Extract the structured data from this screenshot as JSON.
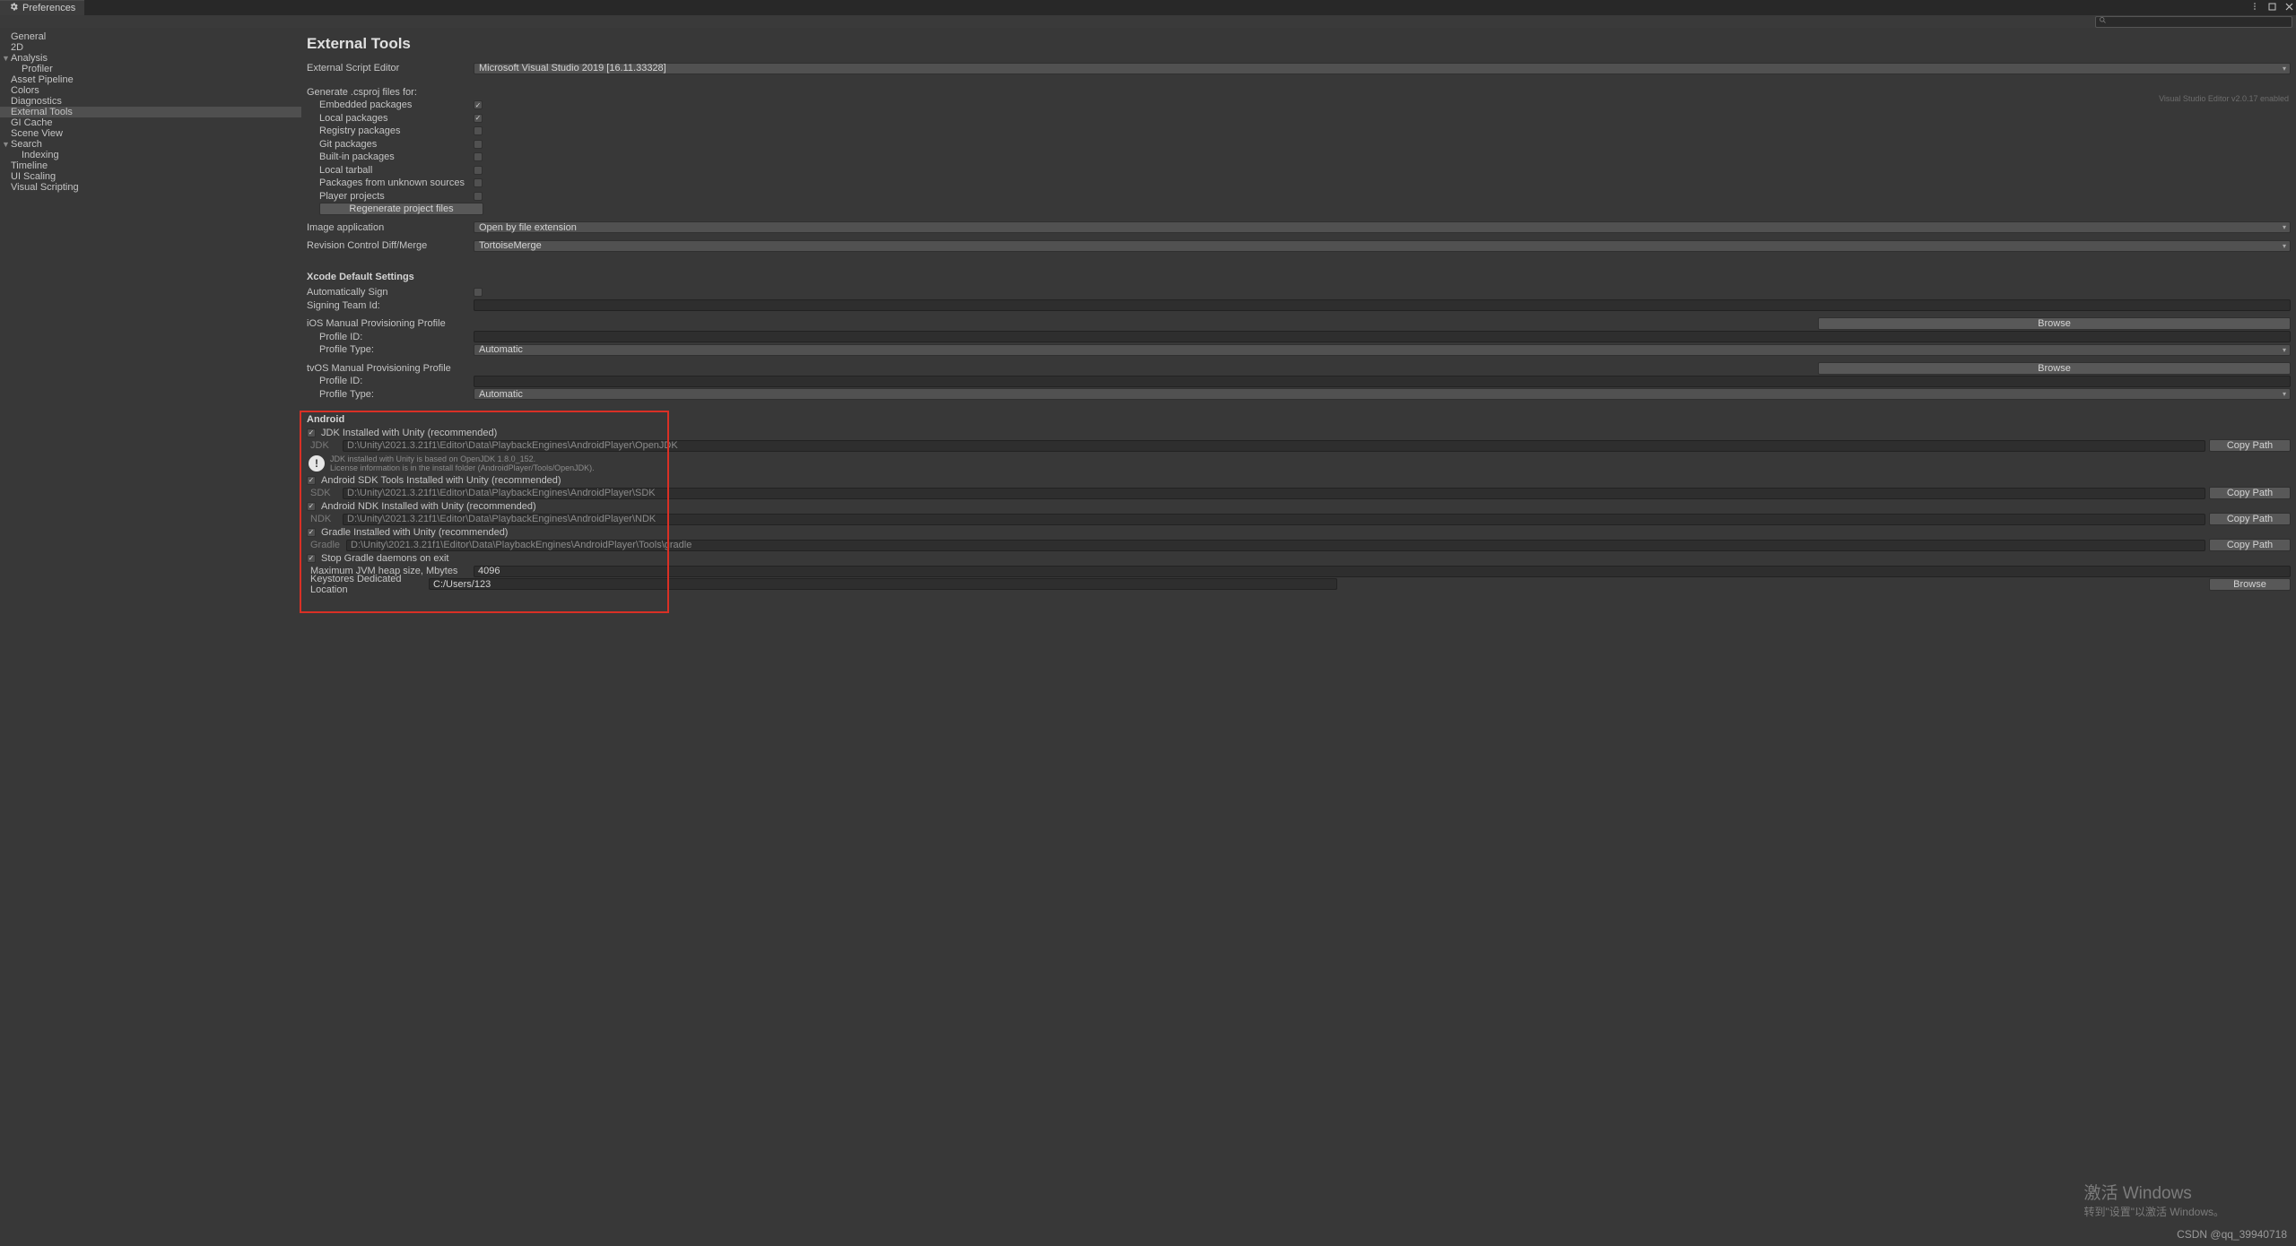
{
  "titlebar": {
    "tab_label": "Preferences"
  },
  "sidebar": {
    "items": [
      {
        "label": "General",
        "lvl": 0
      },
      {
        "label": "2D",
        "lvl": 0
      },
      {
        "label": "Analysis",
        "lvl": 0,
        "fold": true
      },
      {
        "label": "Profiler",
        "lvl": 1
      },
      {
        "label": "Asset Pipeline",
        "lvl": 0
      },
      {
        "label": "Colors",
        "lvl": 0
      },
      {
        "label": "Diagnostics",
        "lvl": 0
      },
      {
        "label": "External Tools",
        "lvl": 0,
        "sel": true
      },
      {
        "label": "GI Cache",
        "lvl": 0
      },
      {
        "label": "Scene View",
        "lvl": 0
      },
      {
        "label": "Search",
        "lvl": 0,
        "fold": true
      },
      {
        "label": "Indexing",
        "lvl": 1
      },
      {
        "label": "Timeline",
        "lvl": 0
      },
      {
        "label": "UI Scaling",
        "lvl": 0
      },
      {
        "label": "Visual Scripting",
        "lvl": 0
      }
    ]
  },
  "page": {
    "title": "External Tools",
    "editor_note": "Visual Studio Editor v2.0.17 enabled",
    "script_editor_label": "External Script Editor",
    "script_editor_value": "Microsoft Visual Studio 2019 [16.11.33328]",
    "csproj_header": "Generate .csproj files for:",
    "csproj": [
      {
        "label": "Embedded packages",
        "checked": true
      },
      {
        "label": "Local packages",
        "checked": true
      },
      {
        "label": "Registry packages",
        "checked": false
      },
      {
        "label": "Git packages",
        "checked": false
      },
      {
        "label": "Built-in packages",
        "checked": false
      },
      {
        "label": "Local tarball",
        "checked": false
      },
      {
        "label": "Packages from unknown sources",
        "checked": false
      },
      {
        "label": "Player projects",
        "checked": false
      }
    ],
    "regen_btn": "Regenerate project files",
    "image_app_label": "Image application",
    "image_app_value": "Open by file extension",
    "diffmerge_label": "Revision Control Diff/Merge",
    "diffmerge_value": "TortoiseMerge",
    "xcode_header": "Xcode Default Settings",
    "auto_sign_label": "Automatically Sign",
    "team_id_label": "Signing Team Id:",
    "ios_header": "iOS Manual Provisioning Profile",
    "tvos_header": "tvOS Manual Provisioning Profile",
    "profile_id_label": "Profile ID:",
    "profile_type_label": "Profile Type:",
    "profile_type_value": "Automatic",
    "browse_btn": "Browse",
    "android_header": "Android",
    "jdk_chk": "JDK Installed with Unity (recommended)",
    "jdk_label": "JDK",
    "jdk_path": "D:\\Unity\\2021.3.21f1\\Editor\\Data\\PlaybackEngines\\AndroidPlayer\\OpenJDK",
    "jdk_info1": "JDK installed with Unity is based on OpenJDK 1.8.0_152.",
    "jdk_info2": "License information is in the install folder (AndroidPlayer/Tools/OpenJDK).",
    "sdk_chk": "Android SDK Tools Installed with Unity (recommended)",
    "sdk_label": "SDK",
    "sdk_path": "D:\\Unity\\2021.3.21f1\\Editor\\Data\\PlaybackEngines\\AndroidPlayer\\SDK",
    "ndk_chk": "Android NDK Installed with Unity (recommended)",
    "ndk_label": "NDK",
    "ndk_path": "D:\\Unity\\2021.3.21f1\\Editor\\Data\\PlaybackEngines\\AndroidPlayer\\NDK",
    "gradle_chk": "Gradle Installed with Unity (recommended)",
    "gradle_label": "Gradle",
    "gradle_path": "D:\\Unity\\2021.3.21f1\\Editor\\Data\\PlaybackEngines\\AndroidPlayer\\Tools\\gradle",
    "stop_daemons_chk": "Stop Gradle daemons on exit",
    "jvm_heap_label": "Maximum JVM heap size, Mbytes",
    "jvm_heap_value": "4096",
    "keystore_label": "Keystores Dedicated Location",
    "keystore_value": "C:/Users/123",
    "copy_btn": "Copy Path"
  },
  "watermark": {
    "win1": "激活 Windows",
    "win2": "转到\"设置\"以激活 Windows。",
    "csdn": "CSDN @qq_39940718"
  }
}
